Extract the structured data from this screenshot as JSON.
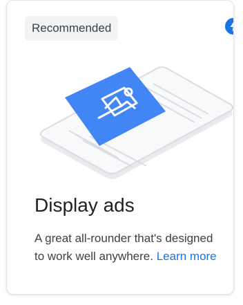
{
  "card": {
    "badge": "Recommended",
    "title": "Display ads",
    "description": "A great all-rounder that's designed to work well anywhere.",
    "learn_more": "Learn more",
    "icon": "bolt-icon"
  },
  "colors": {
    "accent": "#1a73e8",
    "illustration_blue": "#4285f4",
    "badge_bg": "#f1f3f4"
  }
}
